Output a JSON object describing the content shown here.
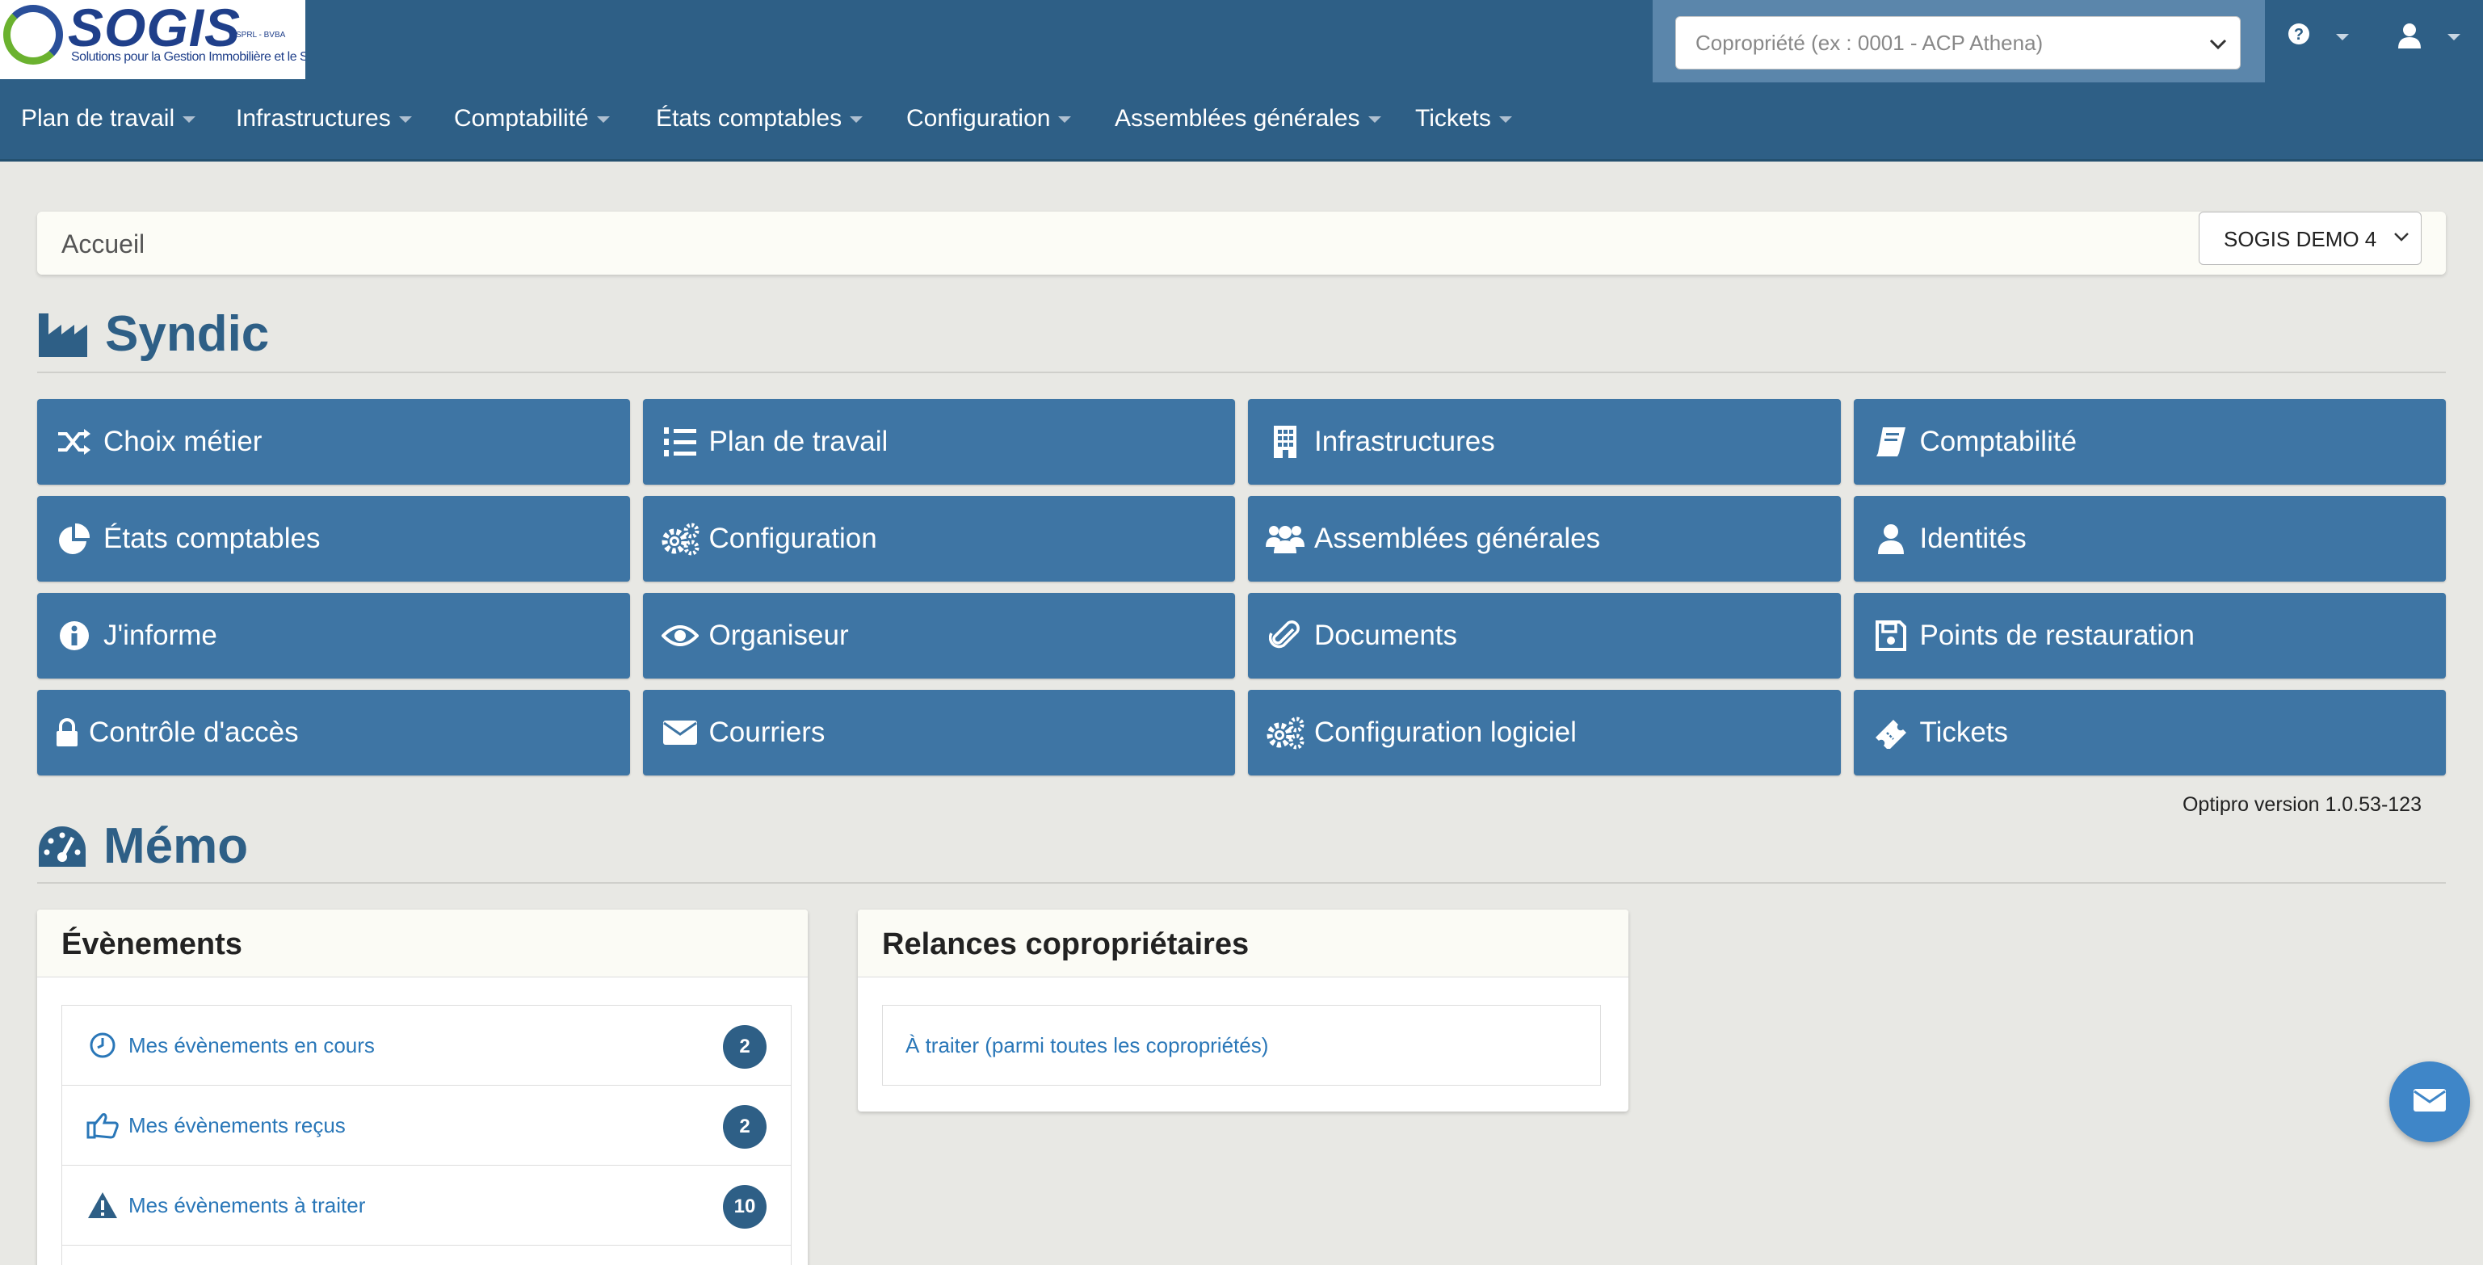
{
  "logo": {
    "word": "SOGIS",
    "legal": "SPRL - BVBA",
    "tagline": "Solutions pour la Gestion Immobilière et le Syndic"
  },
  "header": {
    "copro_placeholder": "Copropriété (ex : 0001 - ACP Athena)",
    "help_icon": "question-circle-icon",
    "user_icon": "user-icon"
  },
  "nav": {
    "items": [
      {
        "label": "Plan de travail"
      },
      {
        "label": "Infrastructures"
      },
      {
        "label": "Comptabilité"
      },
      {
        "label": "États comptables"
      },
      {
        "label": "Configuration"
      },
      {
        "label": "Assemblées générales"
      },
      {
        "label": "Tickets"
      }
    ]
  },
  "breadcrumb": {
    "current": "Accueil",
    "company_select": "SOGIS DEMO 4"
  },
  "syndic": {
    "title": "Syndic",
    "tiles": [
      {
        "label": "Choix métier",
        "icon": "random-icon"
      },
      {
        "label": "Plan de travail",
        "icon": "list-ol-icon"
      },
      {
        "label": "Infrastructures",
        "icon": "building-icon"
      },
      {
        "label": "Comptabilité",
        "icon": "book-icon"
      },
      {
        "label": "États comptables",
        "icon": "pie-chart-icon"
      },
      {
        "label": "Configuration",
        "icon": "cogs-icon"
      },
      {
        "label": "Assemblées générales",
        "icon": "users-icon"
      },
      {
        "label": "Identités",
        "icon": "user-icon"
      },
      {
        "label": "J'informe",
        "icon": "info-circle-icon"
      },
      {
        "label": "Organiseur",
        "icon": "eye-icon"
      },
      {
        "label": "Documents",
        "icon": "paperclip-icon"
      },
      {
        "label": "Points de restauration",
        "icon": "floppy-disk-icon"
      },
      {
        "label": "Contrôle d'accès",
        "icon": "lock-icon"
      },
      {
        "label": "Courriers",
        "icon": "envelope-icon"
      },
      {
        "label": "Configuration logiciel",
        "icon": "cogs-icon"
      },
      {
        "label": "Tickets",
        "icon": "ticket-icon"
      }
    ],
    "version": "Optipro version 1.0.53-123"
  },
  "memo": {
    "title": "Mémo",
    "events_panel": {
      "title": "Évènements",
      "items": [
        {
          "label": "Mes évènements en cours",
          "count": "2",
          "icon": "clock-icon"
        },
        {
          "label": "Mes évènements reçus",
          "count": "2",
          "icon": "thumbs-up-icon"
        },
        {
          "label": "Mes évènements à traiter",
          "count": "10",
          "icon": "warning-icon"
        }
      ]
    },
    "relances_panel": {
      "title": "Relances copropriétaires",
      "items": [
        {
          "label": "À traiter (parmi toutes les copropriétés)"
        }
      ]
    }
  },
  "colors": {
    "topbar": "#2e5f86",
    "tile": "#3e75a4",
    "link": "#2a77b8",
    "page_bg": "#e8e8e4"
  }
}
